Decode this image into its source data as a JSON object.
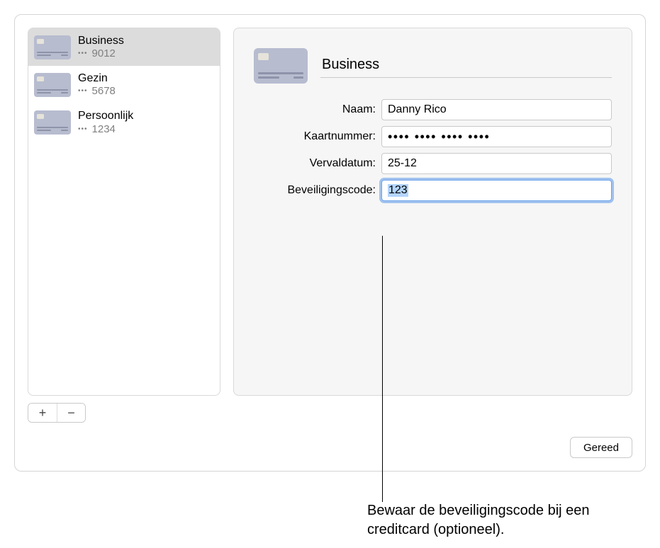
{
  "sidebar": {
    "items": [
      {
        "title": "Business",
        "last4": "9012",
        "selected": true
      },
      {
        "title": "Gezin",
        "last4": "5678",
        "selected": false
      },
      {
        "title": "Persoonlijk",
        "last4": "1234",
        "selected": false
      }
    ]
  },
  "buttons": {
    "add": "+",
    "remove": "−",
    "done": "Gereed"
  },
  "detail": {
    "title": "Business",
    "fields": {
      "name": {
        "label": "Naam:",
        "value": "Danny Rico"
      },
      "number": {
        "label": "Kaartnummer:",
        "masked": "•••• •••• •••• ••••"
      },
      "expiry": {
        "label": "Vervaldatum:",
        "value": "25-12"
      },
      "cvc": {
        "label": "Beveiligingscode:",
        "value": "123"
      }
    }
  },
  "callout": {
    "text": "Bewaar de beveiligingscode bij een creditcard (optioneel)."
  }
}
